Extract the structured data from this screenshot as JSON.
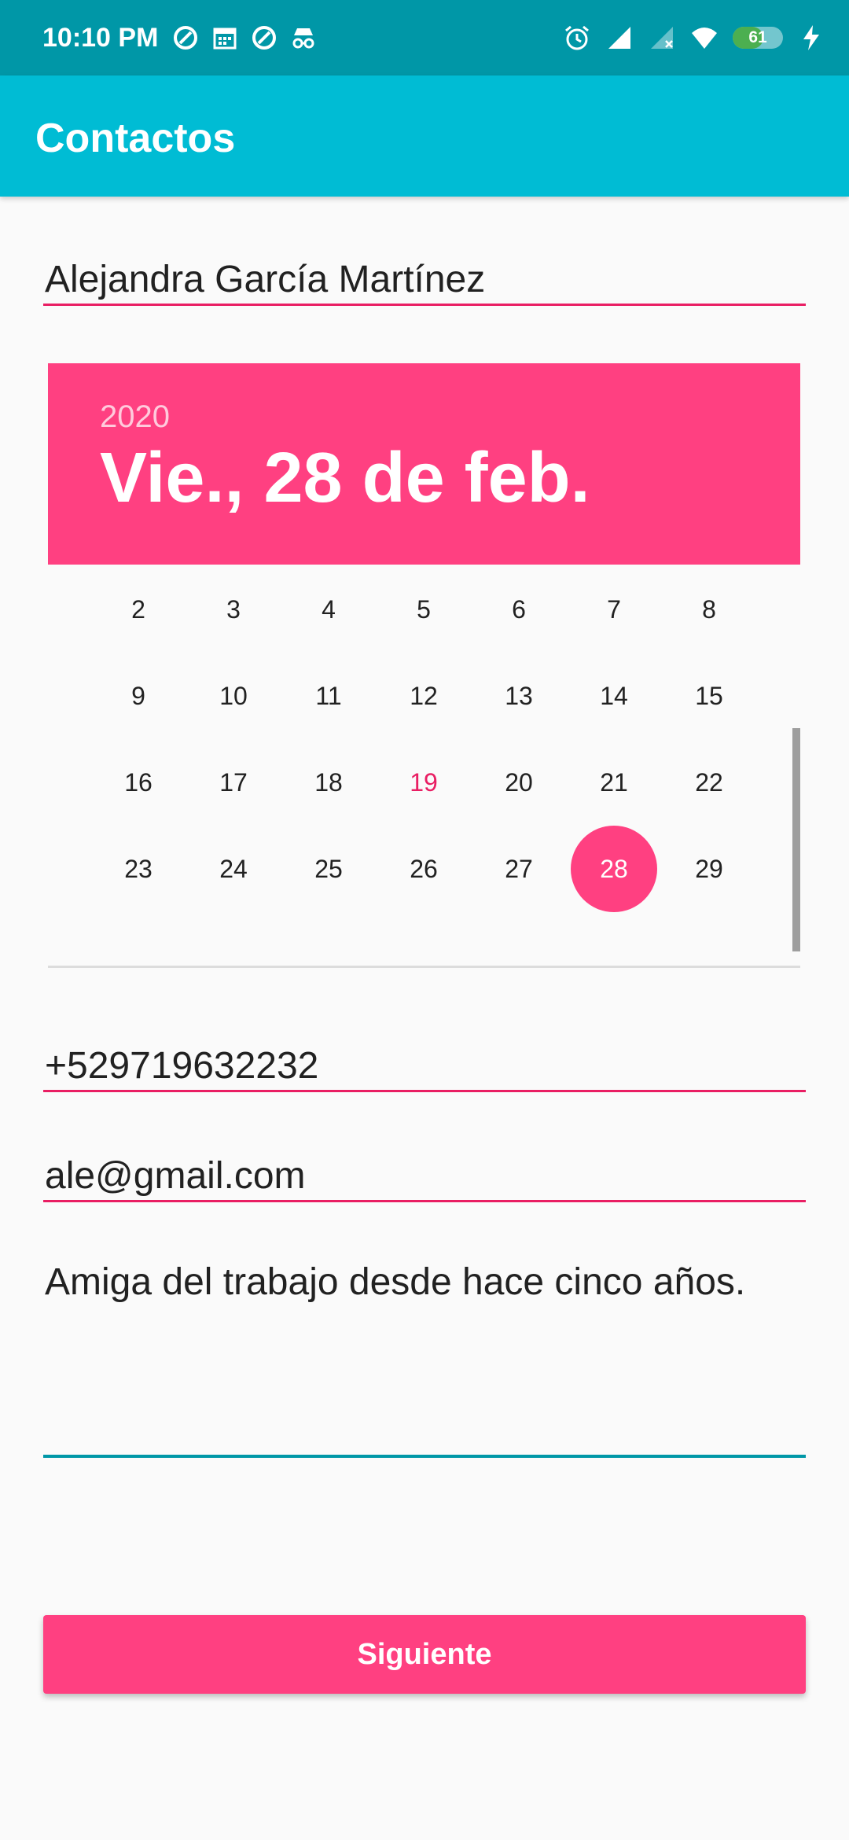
{
  "status_bar": {
    "time": "10:10 PM",
    "icons_left": [
      "sync-icon",
      "calendar-icon",
      "sync-icon",
      "incognito-icon"
    ],
    "icons_right": [
      "alarm-icon",
      "signal-icon",
      "signal-x-icon",
      "wifi-icon",
      "battery-icon",
      "charging-icon"
    ],
    "battery_level": "61",
    "battery_fraction": 0.61
  },
  "app_bar": {
    "title": "Contactos",
    "color": "#00bcd4"
  },
  "form": {
    "name": "Alejandra García Martínez",
    "phone": "+529719632232",
    "email": "ale@gmail.com",
    "description": "Amiga del trabajo desde hace cinco años."
  },
  "date_picker": {
    "year": "2020",
    "selected_label": "Vie., 28 de feb.",
    "accent_color": "#ff4081",
    "selected_day": "28",
    "today_day": "19",
    "weeks": [
      [
        "2",
        "3",
        "4",
        "5",
        "6",
        "7",
        "8"
      ],
      [
        "9",
        "10",
        "11",
        "12",
        "13",
        "14",
        "15"
      ],
      [
        "16",
        "17",
        "18",
        "19",
        "20",
        "21",
        "22"
      ],
      [
        "23",
        "24",
        "25",
        "26",
        "27",
        "28",
        "29"
      ]
    ]
  },
  "actions": {
    "next_label": "Siguiente"
  }
}
